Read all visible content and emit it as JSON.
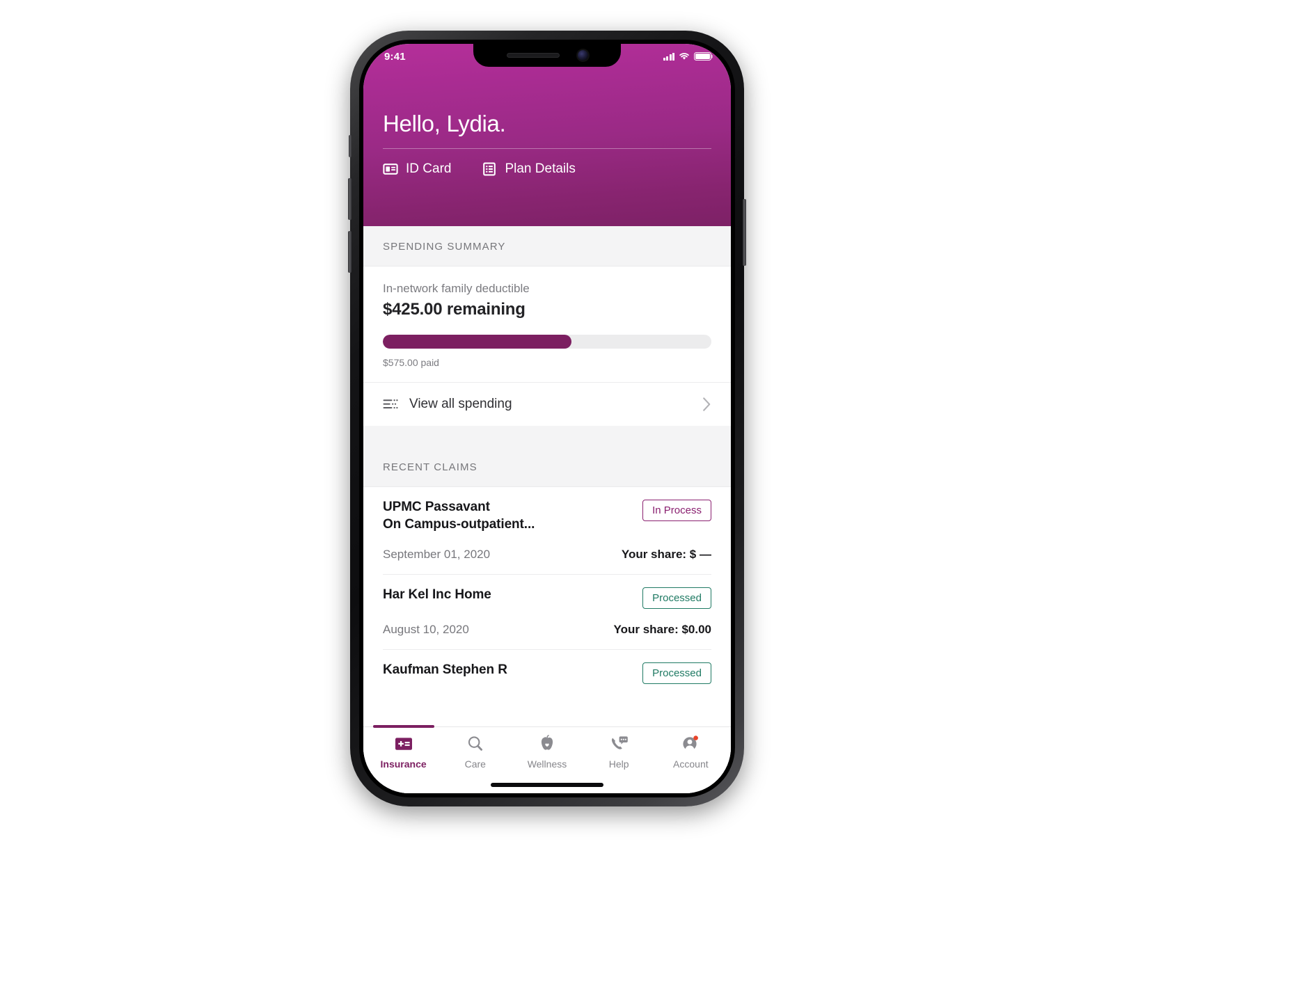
{
  "status_bar": {
    "time": "9:41",
    "signal_icon": "cellular-signal-icon",
    "wifi_icon": "wifi-icon",
    "battery_icon": "battery-full-icon"
  },
  "header": {
    "greeting": "Hello, Lydia.",
    "brand_color": "#8a2070",
    "actions": [
      {
        "label": "ID Card",
        "icon": "id-card-icon"
      },
      {
        "label": "Plan Details",
        "icon": "plan-details-icon"
      }
    ]
  },
  "spending_summary": {
    "section_title": "SPENDING SUMMARY",
    "deductible_label": "In-network family deductible",
    "remaining_amount": "$425.00 remaining",
    "paid_label": "$575.00 paid",
    "progress_percent": 57.5,
    "progress_fill_color": "#7c1f61",
    "progress_track_color": "#ececed",
    "view_all_link": {
      "label": "View all spending",
      "icon": "list-lines-icon",
      "chevron": "chevron-right-icon"
    }
  },
  "recent_claims": {
    "section_title": "RECENT CLAIMS",
    "share_prefix": "Your share:",
    "items": [
      {
        "provider_line1": "UPMC Passavant",
        "provider_line2": "On Campus-outpatient...",
        "status": "In Process",
        "status_type": "inprocess",
        "status_color": "#8a2070",
        "date": "September 01, 2020",
        "share": "Your share: $ —"
      },
      {
        "provider_line1": "Har Kel Inc Home",
        "provider_line2": "",
        "status": "Processed",
        "status_type": "processed",
        "status_color": "#1f7a63",
        "date": "August 10, 2020",
        "share": "Your share: $0.00"
      },
      {
        "provider_line1": "Kaufman Stephen R",
        "provider_line2": "",
        "status": "Processed",
        "status_type": "processed",
        "status_color": "#1f7a63",
        "date": "",
        "share": ""
      }
    ]
  },
  "tab_bar": {
    "active_index": 0,
    "tabs": [
      {
        "label": "Insurance",
        "icon": "insurance-card-icon"
      },
      {
        "label": "Care",
        "icon": "magnifier-search-icon"
      },
      {
        "label": "Wellness",
        "icon": "apple-heart-icon"
      },
      {
        "label": "Help",
        "icon": "phone-chat-icon"
      },
      {
        "label": "Account",
        "icon": "person-avatar-icon"
      }
    ],
    "account_badge": true,
    "badge_color": "#e8442a"
  }
}
